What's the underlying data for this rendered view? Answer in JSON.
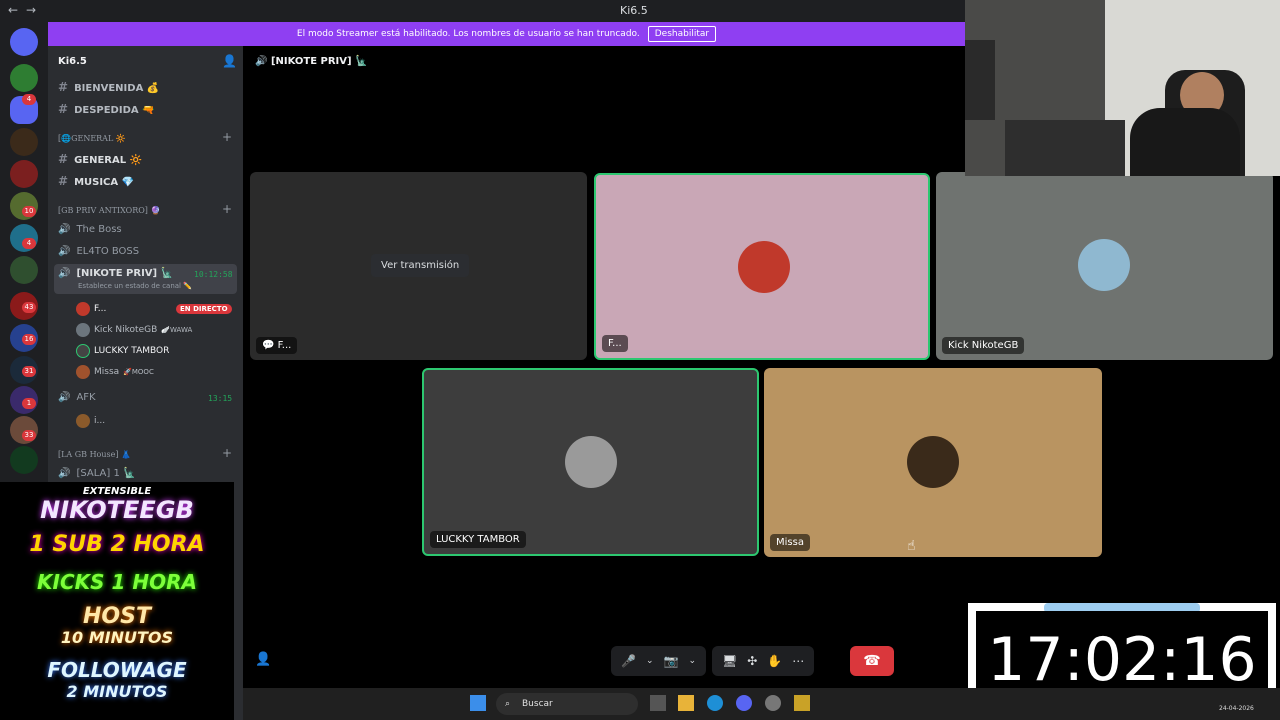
{
  "window": {
    "title": "Ki6.5"
  },
  "banner": {
    "text": "El modo Streamer está habilitado. Los nombres de usuario se han truncado.",
    "button": "Deshabilitar"
  },
  "server_list": {
    "badges": [
      "4",
      "10",
      "4",
      "43",
      "16",
      "31",
      "1",
      "33"
    ]
  },
  "sidebar": {
    "guild_name": "Ki6.5",
    "channels": {
      "bienvenida": "BIENVENIDA 💰",
      "despedida": "DESPEDIDA 🔫",
      "cat_general": "[🌐GENERAL 🔆",
      "general": "GENERAL 🔆",
      "musica": "MUSICA 💎",
      "cat_gb_priv": "[GB PRIV ANTIXORO] 🔮",
      "the_boss": "The Boss",
      "el4to_boss": "EL4TO BOSS",
      "nikote_priv": "[NIKOTE PRIV] 🗽",
      "nikote_status": "Establece un estado de canal ✏️",
      "nikote_timer": "10:12:58",
      "afk": "AFK",
      "afk_timer": "13:15",
      "afk_user": "i...",
      "cat_gb_house": "[LA GB House] 👗",
      "sala": "[SALA] 1 🗽"
    },
    "voice_users": [
      {
        "name": "F...",
        "tag": ""
      },
      {
        "name": "Kick NikoteGB",
        "tag": "🪽WAWA"
      },
      {
        "name": "LUCKKY TAMBOR",
        "tag": ""
      },
      {
        "name": "Missa",
        "tag": "🚀MOOC"
      }
    ],
    "live_badge": "EN DIRECTO"
  },
  "promo": {
    "lines": [
      "EXTENSIBLE",
      "NIKOTEEGB",
      "1 SUB 2 HORA",
      "KICKS 1 HORA",
      "HOST",
      "10 MINUTOS",
      "FOLLOWAGE",
      "2 MINUTOS"
    ]
  },
  "stage": {
    "title": "[NIKOTE PRIV] 🗽",
    "view_stream": "Ver transmisión",
    "tiles": [
      {
        "name": "F...",
        "bg": "#2b2b2b"
      },
      {
        "name": "F...",
        "bg": "#c9a7b6"
      },
      {
        "name": "Kick NikoteGB",
        "bg": "#6f7370"
      },
      {
        "name": "LUCKKY TAMBOR",
        "bg": "#3d3d3d"
      },
      {
        "name": "Missa",
        "bg": "#b99461"
      }
    ]
  },
  "clock": {
    "time": "17:02:16"
  },
  "taskbar": {
    "search": "Buscar",
    "date": "24-04-2026"
  },
  "colors": {
    "accent": "#8f3ff2",
    "speaking": "#2dc770",
    "danger": "#da373c"
  }
}
